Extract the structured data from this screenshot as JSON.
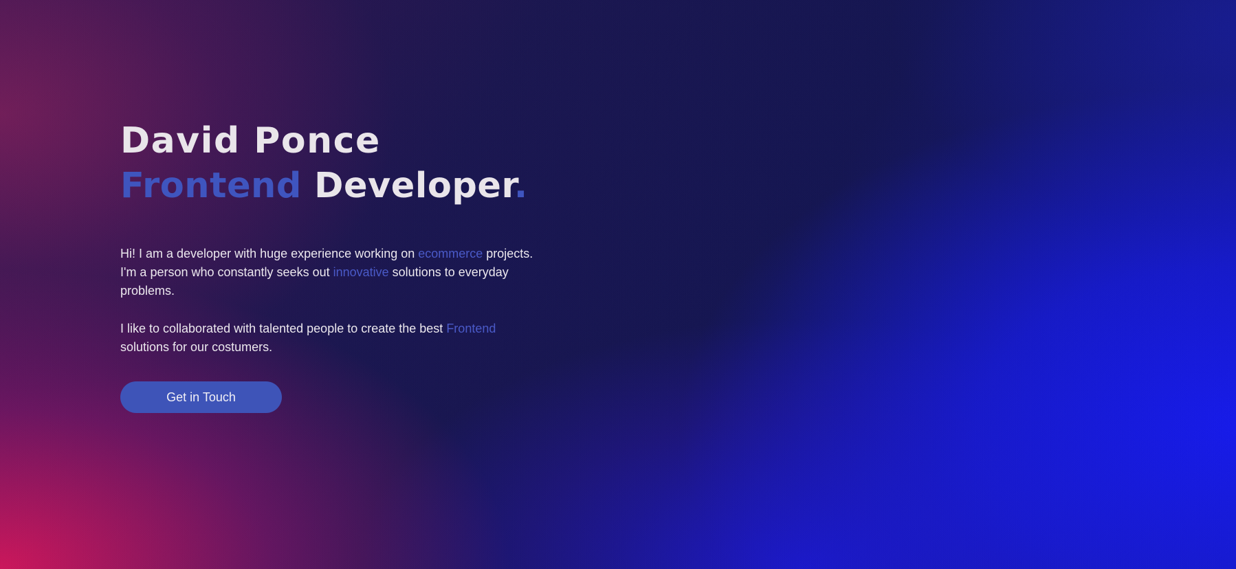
{
  "hero": {
    "name": "David Ponce",
    "role_accent": "Frontend",
    "role_rest": " Developer",
    "role_dot": ".",
    "bio_1": {
      "part1": "Hi! I am a developer with huge experience working on ",
      "hl1": "ecommerce",
      "part2": " projects. I'm a person who constantly seeks out ",
      "hl2": "innovative",
      "part3": " solutions to everyday problems."
    },
    "bio_2": {
      "part1": "I like to collaborated with talented people to create the best ",
      "hl1": "Frontend",
      "part2": " solutions for our costumers."
    },
    "cta_label": "Get in Touch"
  },
  "colors": {
    "accent": "#3f55bf",
    "button": "#3e54b8",
    "text": "#e9e5ea",
    "gradient_pink": "#d6165c",
    "gradient_blue": "#161aeb",
    "gradient_navy": "#141552"
  }
}
